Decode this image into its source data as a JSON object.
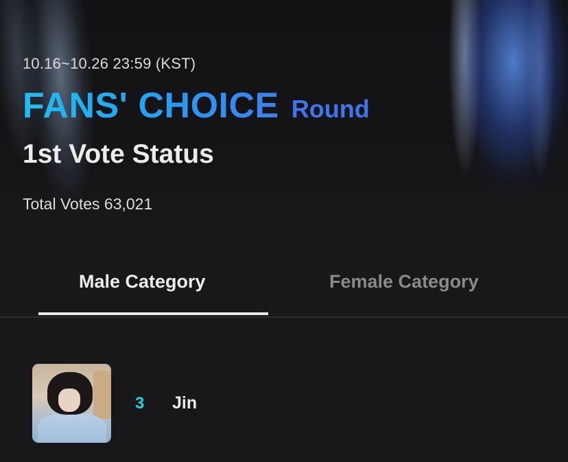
{
  "header": {
    "period": "10.16~10.26 23:59 (KST)",
    "title_main": "FANS' CHOICE",
    "title_suffix": "Round",
    "subtitle": "1st Vote Status",
    "total_votes": "Total Votes 63,021"
  },
  "tabs": [
    {
      "label": "Male Category",
      "active": true
    },
    {
      "label": "Female Category",
      "active": false
    }
  ],
  "ranking": [
    {
      "rank": "3",
      "name": "Jin",
      "avatar": "profile-photo"
    }
  ],
  "colors": {
    "background": "#18181a",
    "title_gradient_start": "#1ec0f0",
    "title_gradient_end": "#3b7ff0",
    "round_text": "#3f76ef",
    "rank_text": "#1fd3e6",
    "active_tab": "#ececec",
    "inactive_tab": "#8a8a8e"
  }
}
